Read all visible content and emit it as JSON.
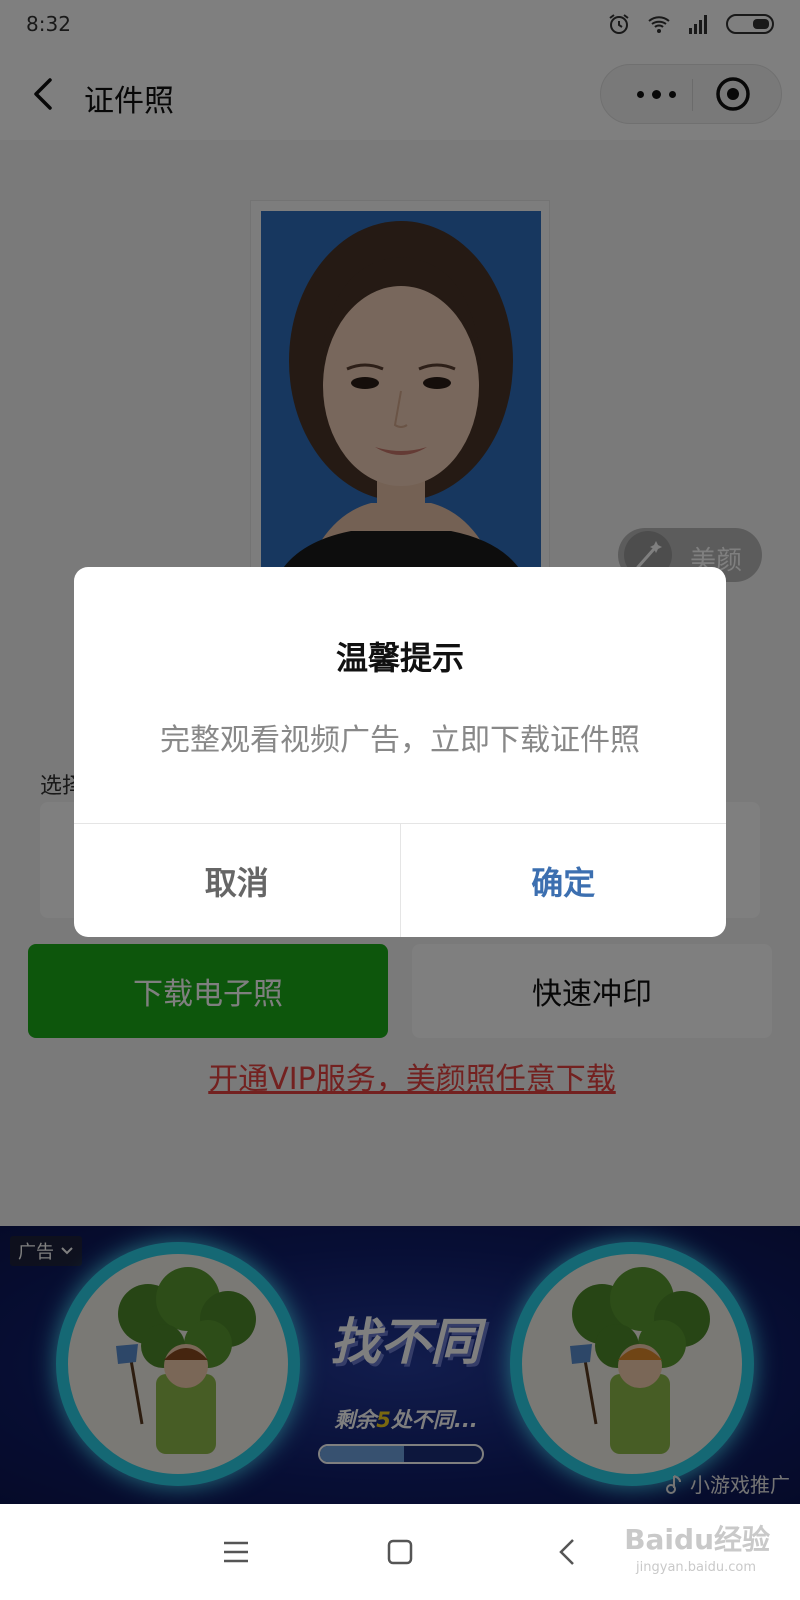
{
  "status_bar": {
    "time": "8:32"
  },
  "nav": {
    "title": "证件照"
  },
  "photo": {
    "background_color": "#2f6fbe"
  },
  "beauty": {
    "label": "美颜"
  },
  "size_select": {
    "label": "选择"
  },
  "actions": {
    "download_label": "下载电子照",
    "print_label": "快速冲印",
    "vip_link": "开通VIP服务，美颜照任意下载"
  },
  "dialog": {
    "title": "温馨提示",
    "message": "完整观看视频广告，立即下载证件照",
    "cancel_label": "取消",
    "confirm_label": "确定"
  },
  "ad": {
    "tag": "广告",
    "title": "找不同",
    "remaining_prefix": "剩余",
    "remaining_count": "5",
    "remaining_suffix": "处不同...",
    "progress": 0.52,
    "promo_label": "小游戏推广"
  },
  "watermark": {
    "brand": "Baidu经验",
    "url": "jingyan.baidu.com"
  },
  "colors": {
    "accent_green": "#1aad19",
    "link_red": "#e64340",
    "confirm_blue": "#3c6fb0"
  }
}
